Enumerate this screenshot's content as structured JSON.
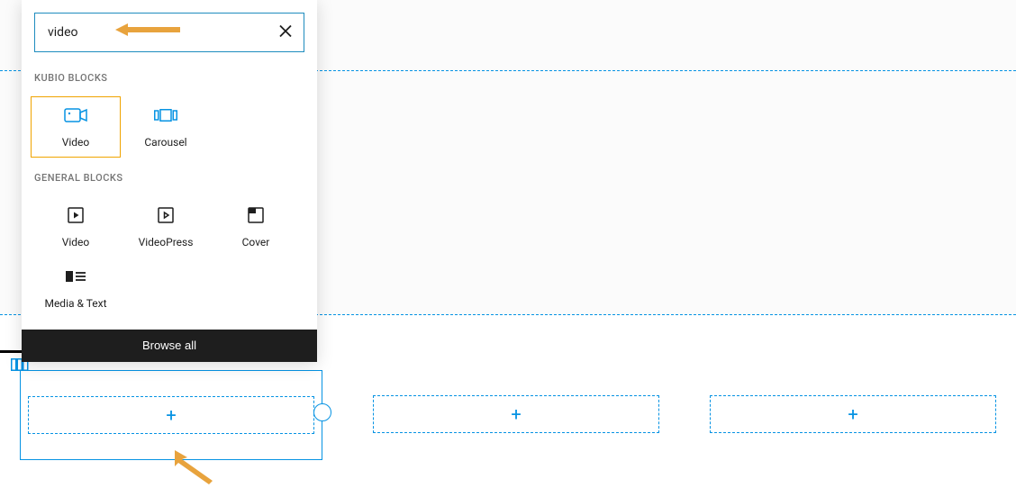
{
  "search": {
    "value": "video"
  },
  "sections": {
    "kubio": {
      "header": "KUBIO BLOCKS",
      "items": [
        {
          "label": "Video"
        },
        {
          "label": "Carousel"
        }
      ]
    },
    "general": {
      "header": "GENERAL BLOCKS",
      "items": [
        {
          "label": "Video"
        },
        {
          "label": "VideoPress"
        },
        {
          "label": "Cover"
        },
        {
          "label": "Media & Text"
        }
      ]
    }
  },
  "browse_all": "Browse all",
  "plus": "+"
}
